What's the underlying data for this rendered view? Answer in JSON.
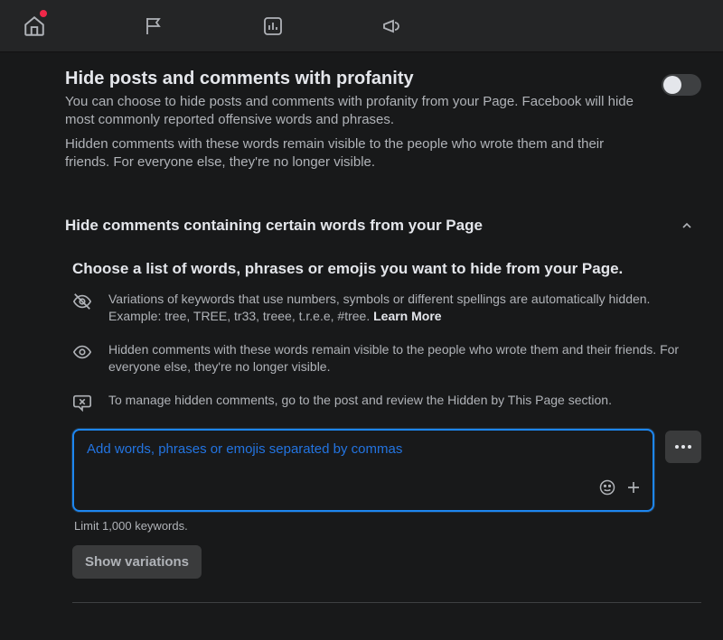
{
  "section1": {
    "title": "Hide posts and comments with profanity",
    "desc": "You can choose to hide posts and comments with profanity from your Page. Facebook will hide most commonly reported offensive words and phrases.",
    "desc2": "Hidden comments with these words remain visible to the people who wrote them and their friends. For everyone else, they're no longer visible.",
    "toggle_on": false
  },
  "section2": {
    "title": "Hide comments containing certain words from your Page",
    "subtitle": "Choose a list of words, phrases or emojis you want to hide from your Page.",
    "info": {
      "variations": "Variations of keywords that use numbers, symbols or different spellings are automatically hidden. Example: tree, TREE, tr33, treee, t.r.e.e, #tree. ",
      "learn_more": "Learn More",
      "hidden_visibility": "Hidden comments with these words remain visible to the people who wrote them and their friends. For everyone else, they're no longer visible.",
      "manage": "To manage hidden comments, go to the post and review the Hidden by This Page section."
    },
    "input": {
      "placeholder": "Add words, phrases or emojis separated by commas",
      "limit_text": "Limit 1,000 keywords.",
      "show_variations_label": "Show variations"
    }
  }
}
